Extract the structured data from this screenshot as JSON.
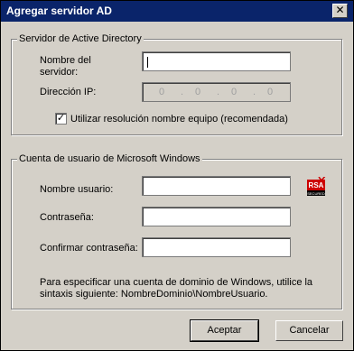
{
  "window": {
    "title": "Agregar servidor AD",
    "close_label": "✕"
  },
  "ad_group": {
    "legend": "Servidor de Active Directory",
    "server_name_label": "Nombre del\nservidor:",
    "server_name_value": "",
    "ip_label": "Dirección IP:",
    "ip_octets": [
      "0",
      "0",
      "0",
      "0"
    ],
    "ip_separator": ".",
    "use_resolution_checked": true,
    "use_resolution_label": "Utilizar resolución nombre equipo (recomendada)"
  },
  "account_group": {
    "legend": "Cuenta de usuario de Microsoft Windows",
    "username_label": "Nombre usuario:",
    "username_value": "",
    "password_label": "Contraseña:",
    "password_value": "",
    "confirm_label": "Confirmar contraseña:",
    "confirm_value": "",
    "rsa_text": "RSA",
    "rsa_subtext": "SECURED",
    "help_text": "Para especificar una cuenta de dominio de Windows, utilice la sintaxis siguiente: NombreDominio\\NombreUsuario."
  },
  "buttons": {
    "accept": "Aceptar",
    "cancel": "Cancelar"
  },
  "colors": {
    "title_bar": "#0a246a",
    "dialog_bg": "#d4d0c8",
    "rsa_red": "#cc0000"
  }
}
